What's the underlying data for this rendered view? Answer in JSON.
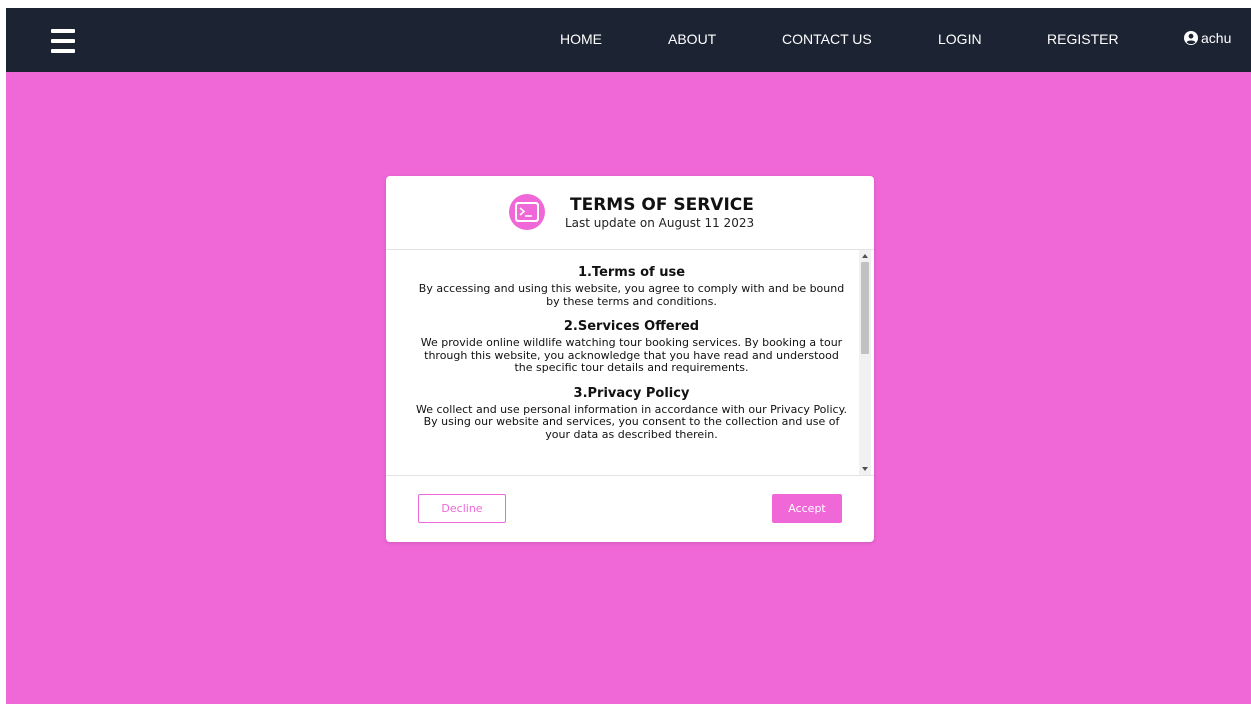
{
  "navbar": {
    "menu_icon": "hamburger-menu-icon",
    "links": [
      "HOME",
      "ABOUT",
      "CONTACT US",
      "LOGIN",
      "REGISTER"
    ],
    "user": {
      "icon": "user-circle-icon",
      "name": "achu"
    }
  },
  "modal": {
    "icon": "terminal-icon",
    "title": "TERMS OF SERVICE",
    "subtitle": "Last update on August 11 2023",
    "sections": [
      {
        "title": "1.Terms of use",
        "text": "By accessing and using this website, you agree to comply with and be bound by these terms and conditions."
      },
      {
        "title": "2.Services Offered",
        "text": "We provide online wildlife watching tour booking services. By booking a tour through this website, you acknowledge that you have read and understood the specific tour details and requirements."
      },
      {
        "title": "3.Privacy Policy",
        "text": "We collect and use personal information in accordance with our Privacy Policy. By using our website and services, you consent to the collection and use of your data as described therein."
      }
    ],
    "decline_label": "Decline",
    "accept_label": "Accept"
  },
  "colors": {
    "page_background": "#f068d8",
    "navbar_background": "#1c2333",
    "accent": "#f068d8"
  }
}
